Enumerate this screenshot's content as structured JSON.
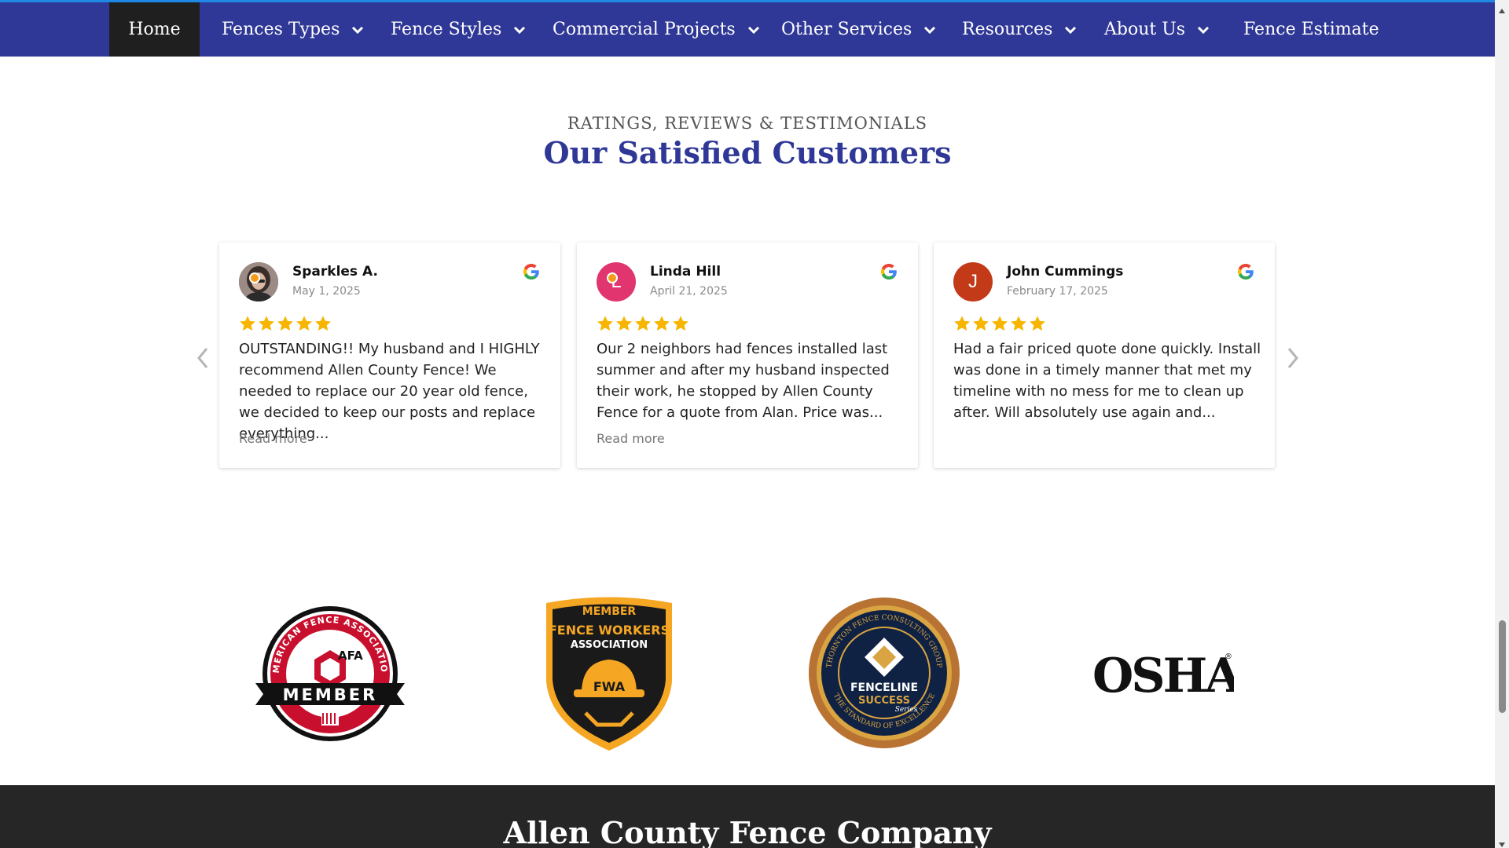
{
  "nav": {
    "items": [
      {
        "label": "Home",
        "active": true,
        "dropdown": false
      },
      {
        "label": "Fences Types",
        "dropdown": true
      },
      {
        "label": "Fence Styles",
        "dropdown": true
      },
      {
        "label": "Commercial Projects",
        "dropdown": true
      },
      {
        "label": "Other Services",
        "dropdown": true
      },
      {
        "label": "Resources",
        "dropdown": true
      },
      {
        "label": "About Us",
        "dropdown": true
      },
      {
        "label": "Fence Estimate",
        "dropdown": false
      }
    ],
    "colors": {
      "background": "#2f3896",
      "active_background": "#1f1f1f",
      "top_accent": "#1e88e5"
    }
  },
  "section": {
    "eyebrow": "RATINGS, REVIEWS & TESTIMONIALS",
    "heading": "Our Satisfied Customers",
    "heading_color": "#2f3896"
  },
  "reviews": [
    {
      "name": "Sparkles A.",
      "date": "May 1, 2025",
      "avatar_icon": "user-photo",
      "avatar_color": "#6b5b55",
      "rating": 5,
      "text": "OUTSTANDING!! My husband and I HIGHLY recommend Allen County Fence! We needed to replace our 20 year old fence, we decided to keep our posts and replace everything...",
      "read_more": "Read more",
      "source_icon": "google-icon"
    },
    {
      "name": "Linda Hill",
      "date": "April 21, 2025",
      "avatar_letter": "L",
      "avatar_color": "#e0356e",
      "rating": 5,
      "text": "Our 2 neighbors had fences installed last summer and after my husband inspected their work, he stopped by Allen County Fence for a quote from Alan. Price was...",
      "read_more": "Read more",
      "source_icon": "google-icon"
    },
    {
      "name": "John Cummings",
      "date": "February 17, 2025",
      "avatar_letter": "J",
      "avatar_color": "#c33a18",
      "rating": 5,
      "text": "Had a fair priced quote done quickly. Install was done in a timely manner that met my timeline with no mess for me to clean up after. Will absolutely use again and...",
      "source_icon": "google-icon"
    }
  ],
  "badges": {
    "afa": {
      "ring_text": "AMERICAN FENCE ASSOCIATION",
      "logo_text": "AFA",
      "banner_text": "MEMBER"
    },
    "fwa": {
      "top_text": "MEMBER",
      "line1": "FENCE WORKERS",
      "line2": "ASSOCIATION",
      "logo_text": "FWA"
    },
    "fenceline": {
      "ring_top": "THORNTON FENCE CONSULTING GROUP",
      "ring_bottom": "THE STANDARD OF EXCELLENCE",
      "line1": "FENCELINE",
      "line2": "SUCCESS",
      "script": "Series"
    },
    "osha": {
      "text": "OSHA"
    }
  },
  "footer": {
    "title": "Allen County Fence Company"
  },
  "colors": {
    "star": "#f7b500",
    "footer_bg": "#262626"
  }
}
